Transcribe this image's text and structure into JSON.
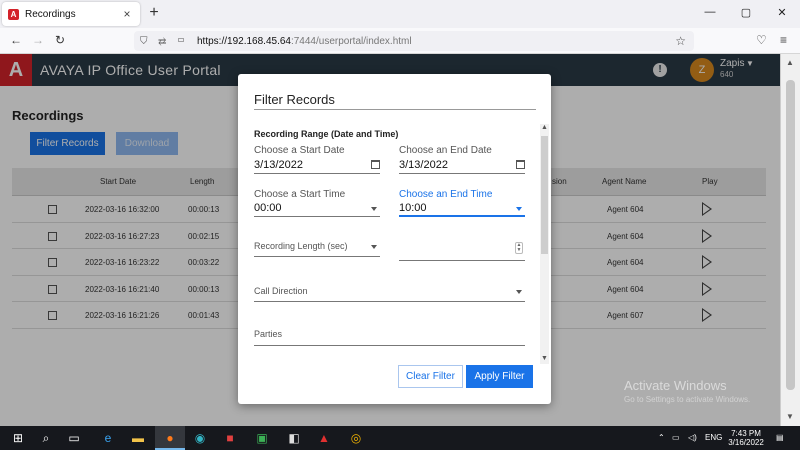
{
  "browser": {
    "tab_title": "Recordings",
    "tab_close": "×",
    "new_tab": "+",
    "url_host": "https://192.168.45.64",
    "url_rest": ":7444/userportal/index.html",
    "win_min": "—",
    "win_max": "▢",
    "win_close": "✕"
  },
  "app": {
    "logo_glyph": "A",
    "title": "AVAYA IP Office User Portal",
    "user_initial": "Z",
    "user_name": "Zapis",
    "user_ext": "640"
  },
  "page": {
    "title": "Recordings",
    "filter_button": "Filter Records",
    "download_button": "Download",
    "columns": [
      "Start Date",
      "Length",
      "sion",
      "Agent Name",
      "Play"
    ],
    "rows": [
      {
        "start": "2022-03-16 16:32:00",
        "length": "00:00:13",
        "agent": "Agent 604"
      },
      {
        "start": "2022-03-16 16:27:23",
        "length": "00:02:15",
        "agent": "Agent 604"
      },
      {
        "start": "2022-03-16 16:23:22",
        "length": "00:03:22",
        "agent": "Agent 604"
      },
      {
        "start": "2022-03-16 16:21:40",
        "length": "00:00:13",
        "agent": "Agent 604"
      },
      {
        "start": "2022-03-16 16:21:26",
        "length": "00:01:43",
        "agent": "Agent 607"
      }
    ]
  },
  "modal": {
    "title": "Filter Records",
    "section": "Recording Range (Date and Time)",
    "start_date_label": "Choose a Start Date",
    "start_date_value": "3/13/2022",
    "end_date_label": "Choose an End Date",
    "end_date_value": "3/13/2022",
    "start_time_label": "Choose a Start Time",
    "start_time_value": "00:00",
    "end_time_label": "Choose an End Time",
    "end_time_value": "10:00",
    "length_label": "Recording Length (sec)",
    "direction_label": "Call Direction",
    "parties_label": "Parties",
    "clear_button": "Clear Filter",
    "apply_button": "Apply Filter"
  },
  "os": {
    "watermark_title": "Activate Windows",
    "watermark_sub": "Go to Settings to activate Windows.",
    "language": "ENG",
    "time": "7:43 PM",
    "date": "3/16/2022"
  },
  "colors": {
    "accent": "#1a73e8",
    "header": "#2a3a46",
    "brand_red": "#d3222a"
  },
  "icons": [
    "back-icon",
    "forward-icon",
    "reload-icon",
    "shield-icon",
    "star-icon",
    "pocket-icon",
    "menu-icon",
    "alert-icon",
    "calendar-icon",
    "chevron-down-icon",
    "play-icon",
    "windows-icon",
    "search-icon",
    "task-view-icon",
    "edge-icon",
    "explorer-icon",
    "firefox-icon",
    "chrome-icon"
  ]
}
